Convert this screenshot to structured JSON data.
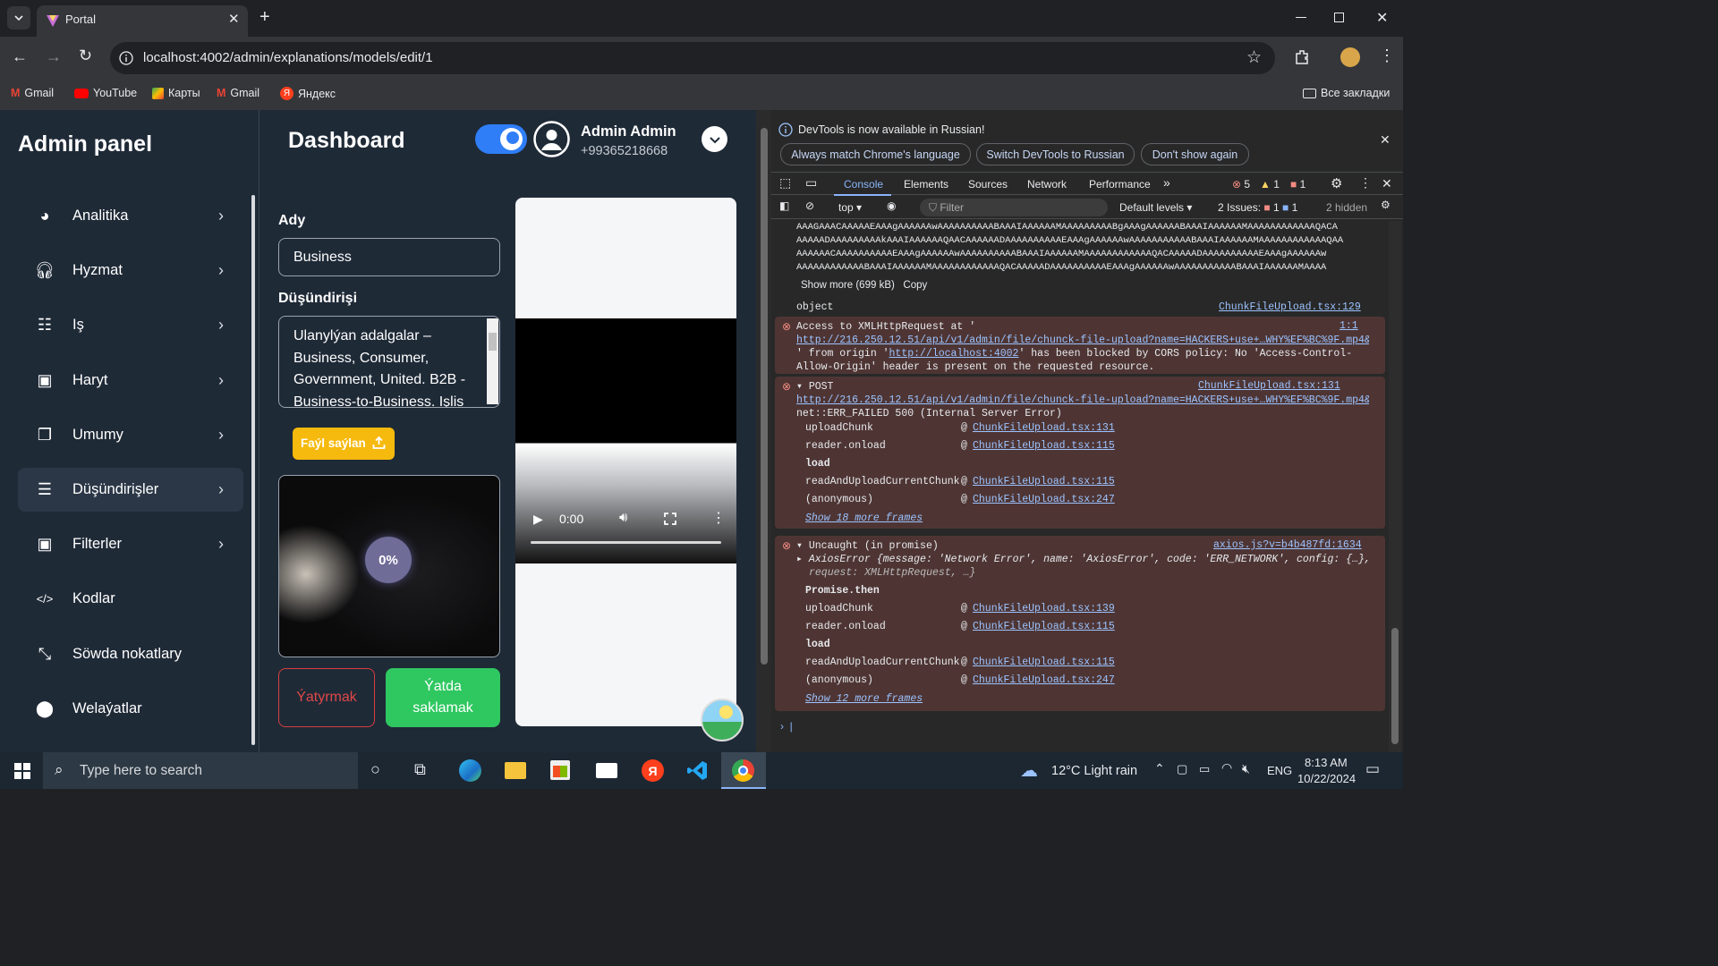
{
  "browser": {
    "tab_title": "Portal",
    "url": "localhost:4002/admin/explanations/models/edit/1",
    "bookmarks": [
      "Gmail",
      "YouTube",
      "Карты",
      "Gmail",
      "Яндекс"
    ],
    "all_bookmarks": "Все закладки"
  },
  "sidebar": {
    "title": "Admin panel",
    "items": [
      {
        "label": "Analitika",
        "icon": "pie-chart-icon"
      },
      {
        "label": "Hyzmat",
        "icon": "headset-icon"
      },
      {
        "label": "Iş",
        "icon": "list-card-icon"
      },
      {
        "label": "Haryt",
        "icon": "product-icon"
      },
      {
        "label": "Umumy",
        "icon": "copy-icon"
      },
      {
        "label": "Düşündirişler",
        "icon": "users-list-icon",
        "active": true
      },
      {
        "label": "Filterler",
        "icon": "filter-box-icon"
      },
      {
        "label": "Kodlar",
        "icon": "code-icon"
      },
      {
        "label": "Söwda nokatlary",
        "icon": "shrink-icon"
      },
      {
        "label": "Welaýatlar",
        "icon": "location-pin-icon"
      }
    ]
  },
  "header": {
    "title": "Dashboard",
    "user_name": "Admin Admin",
    "user_phone": "+99365218668"
  },
  "form": {
    "name_label": "Ady",
    "name_value": "Business",
    "desc_label": "Düşündirişi",
    "desc_value": "Ulanylýan adalgalar – Business, Consumer, Government, United. B2B - Business-to-Business. Işlis",
    "upload_button": "Faýl saýlan",
    "progress": "0%",
    "cancel_button": "Ýatyrmak",
    "save_button": "Ýatda saklamak"
  },
  "video": {
    "time": "0:00"
  },
  "devtools": {
    "banner": "DevTools is now available in Russian!",
    "banner_buttons": [
      "Always match Chrome's language",
      "Switch DevTools to Russian",
      "Don't show again"
    ],
    "tabs": [
      "Elements",
      "Console",
      "Sources",
      "Network",
      "Performance"
    ],
    "active_tab": "Console",
    "errors_count": "5",
    "warnings_count": "1",
    "info_count": "1",
    "context": "top",
    "filter_placeholder": "Filter",
    "levels": "Default levels",
    "issues_label": "2 Issues:",
    "issues_err": "1",
    "issues_info": "1",
    "hidden": "2 hidden",
    "base64": [
      "AAAGAAACAAAAAEAAAgAAAAAAwAAAAAAAAAABAAAIAAAAAAMAAAAAAAAABgAAAgAAAAAABAAAIAAAAAAMAAAAAAAAAAAAQACA",
      "AAAAADAAAAAAAAAkAAAIAAAAAAQAACAAAAAADAAAAAAAAAAEAAAgAAAAAAwAAAAAAAAAAABAAAIAAAAAAMAAAAAAAAAAAAQAA",
      "AAAAAACAAAAAAAAAAEAAAgAAAAAAwAAAAAAAAAABAAAIAAAAAAMAAAAAAAAAAAAQACAAAAADAAAAAAAAAAEAAAgAAAAAAw",
      "AAAAAAAAAAAABAAAIAAAAAAMAAAAAAAAAAAAQACAAAAADAAAAAAAAAAEAAAgAAAAAAwAAAAAAAAAAABAAAIAAAAAAMAAAA"
    ],
    "show_more": "Show more (699 kB)",
    "copy": "Copy",
    "object_text": "object",
    "object_src": "ChunkFileUpload.tsx:129",
    "cors": {
      "l1": "Access to XMLHttpRequest at '",
      "url": "http://216.250.12.51/api/v1/admin/file/chunck-file-upload?name=HACKERS+use+…WHY%EF%BC%9F.mp4&…",
      "l3a": "' from origin '",
      "origin": "http://localhost:4002",
      "l3b": "' has been blocked by CORS policy: No 'Access-Control-",
      "l4": "Allow-Origin' header is present on the requested resource.",
      "src": "1:1"
    },
    "post": {
      "label": "POST",
      "url": "http://216.250.12.51/api/v1/admin/file/chunck-file-upload?name=HACKERS+use+…WHY%EF%BC%9F.mp4&…",
      "status": "net::ERR_FAILED 500 (Internal Server Error)",
      "src": "ChunkFileUpload.tsx:131",
      "frames": [
        {
          "fn": "uploadChunk",
          "at": "@",
          "src": "ChunkFileUpload.tsx:131"
        },
        {
          "fn": "reader.onload",
          "at": "@",
          "src": "ChunkFileUpload.tsx:115"
        },
        {
          "fn": "load",
          "at": "",
          "src": ""
        },
        {
          "fn": "readAndUploadCurrentChunk",
          "at": "@",
          "src": "ChunkFileUpload.tsx:115"
        },
        {
          "fn": "(anonymous)",
          "at": "@",
          "src": "ChunkFileUpload.tsx:247"
        }
      ],
      "more": "Show 18 more frames"
    },
    "uncaught": {
      "label": "Uncaught (in promise)",
      "src": "axios.js?v=b4b487fd:1634",
      "l2": "AxiosError {message: 'Network Error', name: 'AxiosError', code: 'ERR_NETWORK', config: {…},",
      "l3": "request: XMLHttpRequest, …}",
      "frames": [
        {
          "fn": "Promise.then",
          "at": "",
          "src": ""
        },
        {
          "fn": "uploadChunk",
          "at": "@",
          "src": "ChunkFileUpload.tsx:139"
        },
        {
          "fn": "reader.onload",
          "at": "@",
          "src": "ChunkFileUpload.tsx:115"
        },
        {
          "fn": "load",
          "at": "",
          "src": ""
        },
        {
          "fn": "readAndUploadCurrentChunk",
          "at": "@",
          "src": "ChunkFileUpload.tsx:115"
        },
        {
          "fn": "(anonymous)",
          "at": "@",
          "src": "ChunkFileUpload.tsx:247"
        }
      ],
      "more": "Show 12 more frames"
    }
  },
  "taskbar": {
    "search": "Type here to search",
    "weather": "12°C  Light rain",
    "lang": "ENG",
    "time": "8:13 AM",
    "date": "10/22/2024"
  }
}
